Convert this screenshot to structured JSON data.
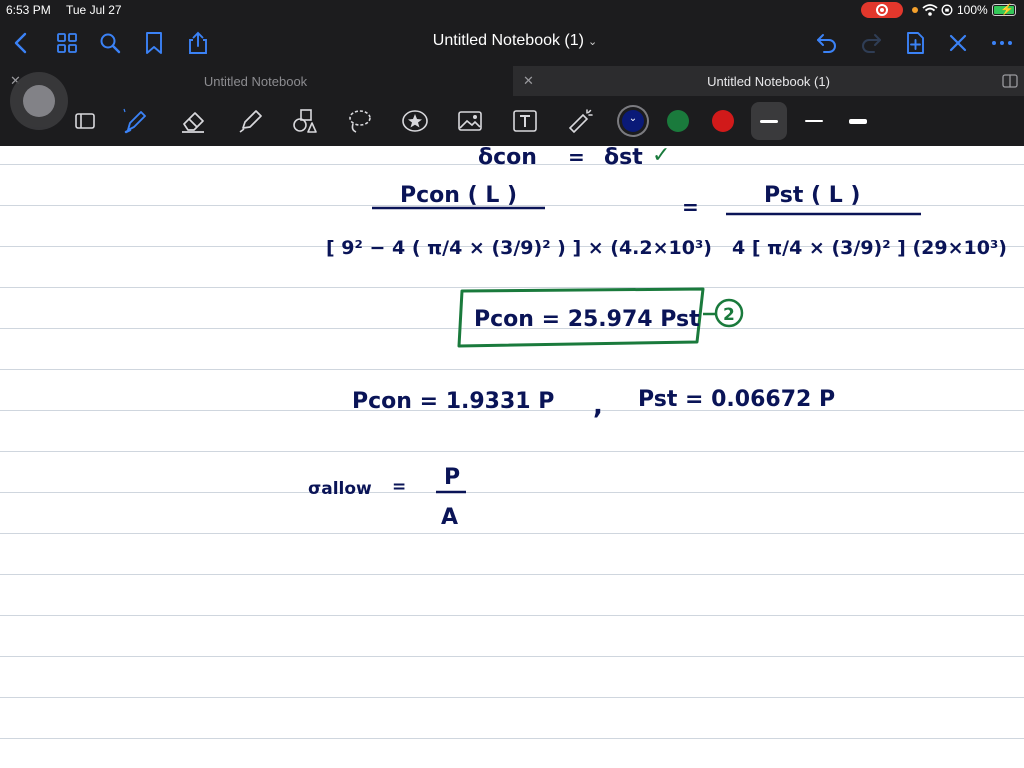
{
  "status_bar": {
    "time": "6:53 PM",
    "date": "Tue Jul 27",
    "battery": "100%"
  },
  "nav": {
    "title": "Untitled Notebook (1)"
  },
  "tabs": [
    {
      "label": "Untitled Notebook",
      "active": false
    },
    {
      "label": "Untitled Notebook (1)",
      "active": true
    }
  ],
  "toolbar": {
    "tools": [
      "document-icon",
      "pen-icon",
      "eraser-icon",
      "highlighter-icon",
      "shapes-icon",
      "lasso-icon",
      "sticker-icon",
      "image-icon",
      "text-icon",
      "laser-pointer-icon"
    ],
    "colors": [
      "#0a1a78",
      "#1a7a3c",
      "#d11a1a"
    ],
    "selected_color": "#0a1a78",
    "selected_color_mark": "⌄",
    "stroke_widths": [
      "thin",
      "medium",
      "thick"
    ]
  },
  "handwriting": {
    "line0_left": "δcon",
    "line0_eq": "=",
    "line0_right": "δst",
    "line0_mark": "✓",
    "frac_left_num": "Pcon ( L )",
    "frac_left_den": "[ 9² − 4 ( π/4 × (3/9)² ) ] × (4.2×10³)",
    "frac_eq": "=",
    "frac_right_num": "Pst ( L )",
    "frac_right_den": "4 [ π/4 × (3/9)² ] (29×10³)",
    "boxed_eq": "Pcon = 25.974 Pst",
    "eq_number": "2",
    "pcon_result": "Pcon = 1.9331 P",
    "comma": ",",
    "pst_result": "Pst = 0.06672 P",
    "sigma_allow": "σallow",
    "sigma_eq": "=",
    "sigma_num": "P",
    "sigma_den": "A"
  }
}
